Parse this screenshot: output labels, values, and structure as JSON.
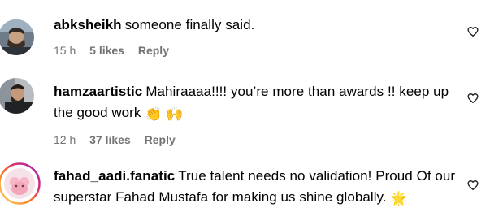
{
  "comments": [
    {
      "username": "abksheikh",
      "text": "someone finally said.",
      "time": "15 h",
      "likes": "5 likes",
      "reply": "Reply"
    },
    {
      "username": "hamzaartistic",
      "text": "Mahiraaaa!!!! you’re more than awards !! keep up the good work",
      "emojis": "👏 🙌",
      "time": "12 h",
      "likes": "37 likes",
      "reply": "Reply"
    },
    {
      "username": "fahad_aadi.fanatic",
      "text": "True talent needs no validation! Proud Of our superstar Fahad Mustafa for making us shine globally.",
      "emojis": "🌟"
    }
  ],
  "icons": {
    "like": "heart-outline-icon"
  },
  "colors": {
    "text": "#000000",
    "meta": "#737373",
    "story_ring": "#d6249f"
  }
}
